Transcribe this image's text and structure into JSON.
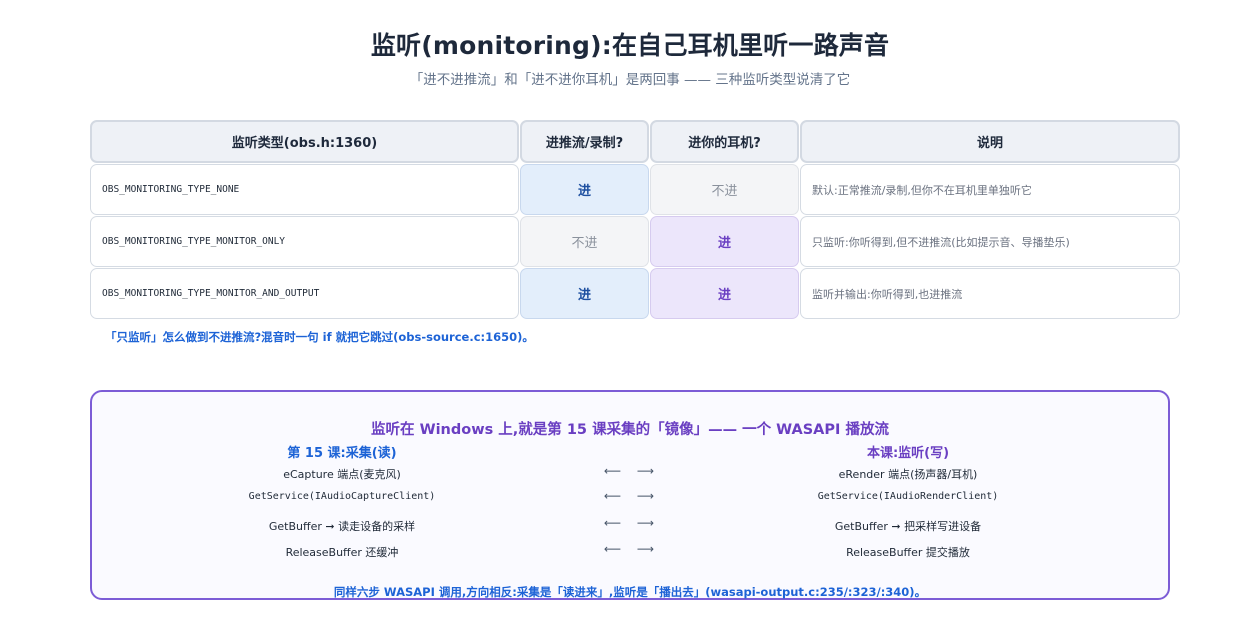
{
  "header": {
    "title": "监听(monitoring):在自己耳机里听一路声音",
    "subtitle": "「进不进推流」和「进不进你耳机」是两回事 —— 三种监听类型说清了它"
  },
  "table": {
    "headers": [
      "监听类型(obs.h:1360)",
      "进推流/录制?",
      "进你的耳机?",
      "说明"
    ],
    "rows": [
      {
        "type": "OBS_MONITORING_TYPE_NONE",
        "stream": "进",
        "stream_state": "yes",
        "ear": "不进",
        "ear_state": "no",
        "desc": "默认:正常推流/录制,但你不在耳机里单独听它"
      },
      {
        "type": "OBS_MONITORING_TYPE_MONITOR_ONLY",
        "stream": "不进",
        "stream_state": "no",
        "ear": "进",
        "ear_state": "yes",
        "desc": "只监听:你听得到,但不进推流(比如提示音、导播垫乐)"
      },
      {
        "type": "OBS_MONITORING_TYPE_MONITOR_AND_OUTPUT",
        "stream": "进",
        "stream_state": "yes",
        "ear": "进",
        "ear_state": "yes",
        "desc": "监听并输出:你听得到,也进推流"
      }
    ],
    "note": "「只监听」怎么做到不进推流?混音时一句 if 就把它跳过(obs-source.c:1650)。"
  },
  "panel": {
    "title": "监听在 Windows 上,就是第 15 课采集的「镜像」—— 一个 WASAPI 播放流",
    "left_head": "第 15 课:采集(读)",
    "right_head": "本课:监听(写)",
    "arrows": "⟵ ⟶",
    "rows": [
      {
        "left": "eCapture 端点(麦克风)",
        "right": "eRender 端点(扬声器/耳机)",
        "mono": false
      },
      {
        "left": "GetService(IAudioCaptureClient)",
        "right": "GetService(IAudioRenderClient)",
        "mono": true
      },
      {
        "left": "GetBuffer ➞ 读走设备的采样",
        "right": "GetBuffer ➞ 把采样写进设备",
        "mono": false
      },
      {
        "left": "ReleaseBuffer 还缓冲",
        "right": "ReleaseBuffer 提交播放",
        "mono": false
      }
    ],
    "note": "同样六步 WASAPI 调用,方向相反:采集是「读进来」,监听是「播出去」(wasapi-output.c:235/:323/:340)。"
  },
  "colors": {
    "accent_blue": "#1d63d6",
    "accent_purple": "#6a3fc2",
    "yes_blue_bg": "#e3eefb",
    "yes_purple_bg": "#ece6fb",
    "no_bg": "#f4f5f7"
  }
}
